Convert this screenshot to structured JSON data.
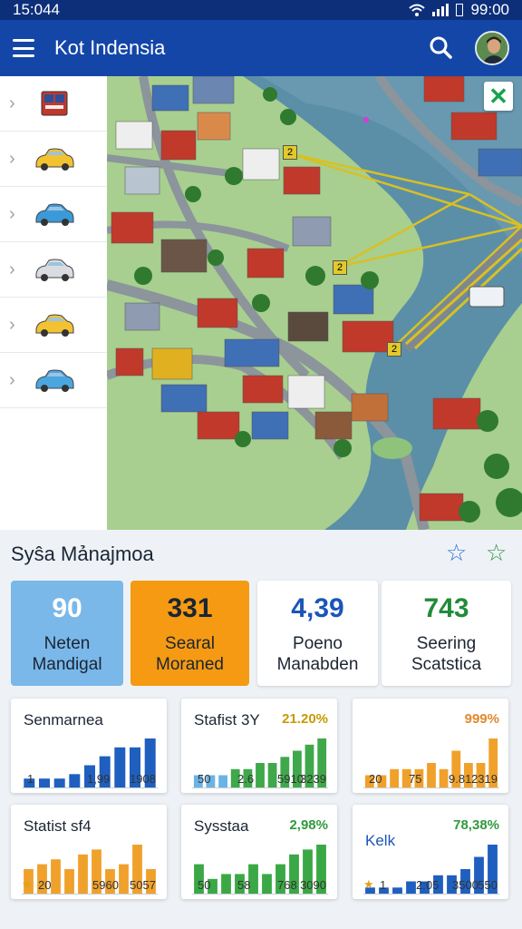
{
  "status": {
    "time": "15:044",
    "clock": "99:00"
  },
  "app": {
    "title": "Kot Indensia"
  },
  "sidebar": {
    "items": [
      {
        "icon": "bus-icon",
        "color": "#c0392b"
      },
      {
        "icon": "car-icon",
        "color": "#f2c230"
      },
      {
        "icon": "car-icon",
        "color": "#3a9ad9"
      },
      {
        "icon": "car-icon",
        "color": "#d9dde2"
      },
      {
        "icon": "car-icon",
        "color": "#f2c230"
      },
      {
        "icon": "car-icon",
        "color": "#4aa6df"
      }
    ]
  },
  "map": {
    "markers": [
      "2",
      "2",
      "2"
    ],
    "close": "✕"
  },
  "panel": {
    "title": "Syŝa Mảnajmoa"
  },
  "kpis": [
    {
      "value": "90",
      "line1": "Neten",
      "line2": "Mandigal",
      "bg": "#7ab8ea",
      "color": "#ffffff"
    },
    {
      "value": "331",
      "line1": "Searal",
      "line2": "Moraned",
      "bg": "#f59a12",
      "color": "#1b2533"
    },
    {
      "value": "4,39",
      "line1": "Poeno",
      "line2": "Manabden",
      "bg": "#ffffff",
      "color": "#1a56b8"
    },
    {
      "value": "743",
      "line1": "Seering",
      "line2": "Scatstica",
      "bg": "#ffffff",
      "color": "#228b3a"
    }
  ],
  "minis": [
    {
      "title": "Senmarnea",
      "pct": "",
      "color": "#1f5fbf",
      "light": "#1f5fbf",
      "values": [
        2,
        2,
        2,
        3,
        5,
        7,
        9,
        9,
        11
      ],
      "axis": [
        "1",
        "1,99",
        "1908"
      ],
      "star": false
    },
    {
      "title": "Stafist 3Y",
      "pct": "21.20%",
      "pctColor": "#c79a00",
      "color": "#3fa84a",
      "light": "#6ab3e6",
      "values": [
        2,
        2,
        2,
        3,
        3,
        4,
        4,
        5,
        6,
        7,
        8
      ],
      "axis": [
        "50",
        "2.6",
        "5910",
        "3239"
      ],
      "star": false
    },
    {
      "title": "",
      "pct": "999%",
      "pctColor": "#e0892e",
      "color": "#f0a12b",
      "light": "#f0a12b",
      "values": [
        2,
        2,
        3,
        3,
        3,
        4,
        3,
        6,
        4,
        4,
        8
      ],
      "axis": [
        "20",
        "75",
        "9.81",
        "2319"
      ],
      "star": false
    },
    {
      "title": "Statist sf4",
      "pct": "",
      "color": "#f0a12b",
      "light": "#f0a12b",
      "values": [
        5,
        6,
        7,
        5,
        8,
        9,
        5,
        6,
        10,
        5
      ],
      "axis": [
        "20",
        "5960",
        "5057"
      ],
      "star": true
    },
    {
      "title": "Sysstaa",
      "pct": "2,98%",
      "pctColor": "#2f9a3d",
      "color": "#3aa845",
      "light": "#3aa845",
      "values": [
        6,
        3,
        4,
        4,
        6,
        4,
        6,
        8,
        9,
        10
      ],
      "axis": [
        "50",
        "58",
        "768",
        "3090"
      ],
      "star": false
    },
    {
      "title": "Kelk",
      "pct": "78,38%",
      "pctColor": "#2f9a3d",
      "color": "#1f5fbf",
      "light": "#1f5fbf",
      "values": [
        1,
        1,
        1,
        2,
        2,
        3,
        3,
        4,
        6,
        8
      ],
      "axis": [
        "1",
        "2:05",
        "3500",
        "550"
      ],
      "star": true,
      "titleColor": "#1a56b8"
    }
  ]
}
